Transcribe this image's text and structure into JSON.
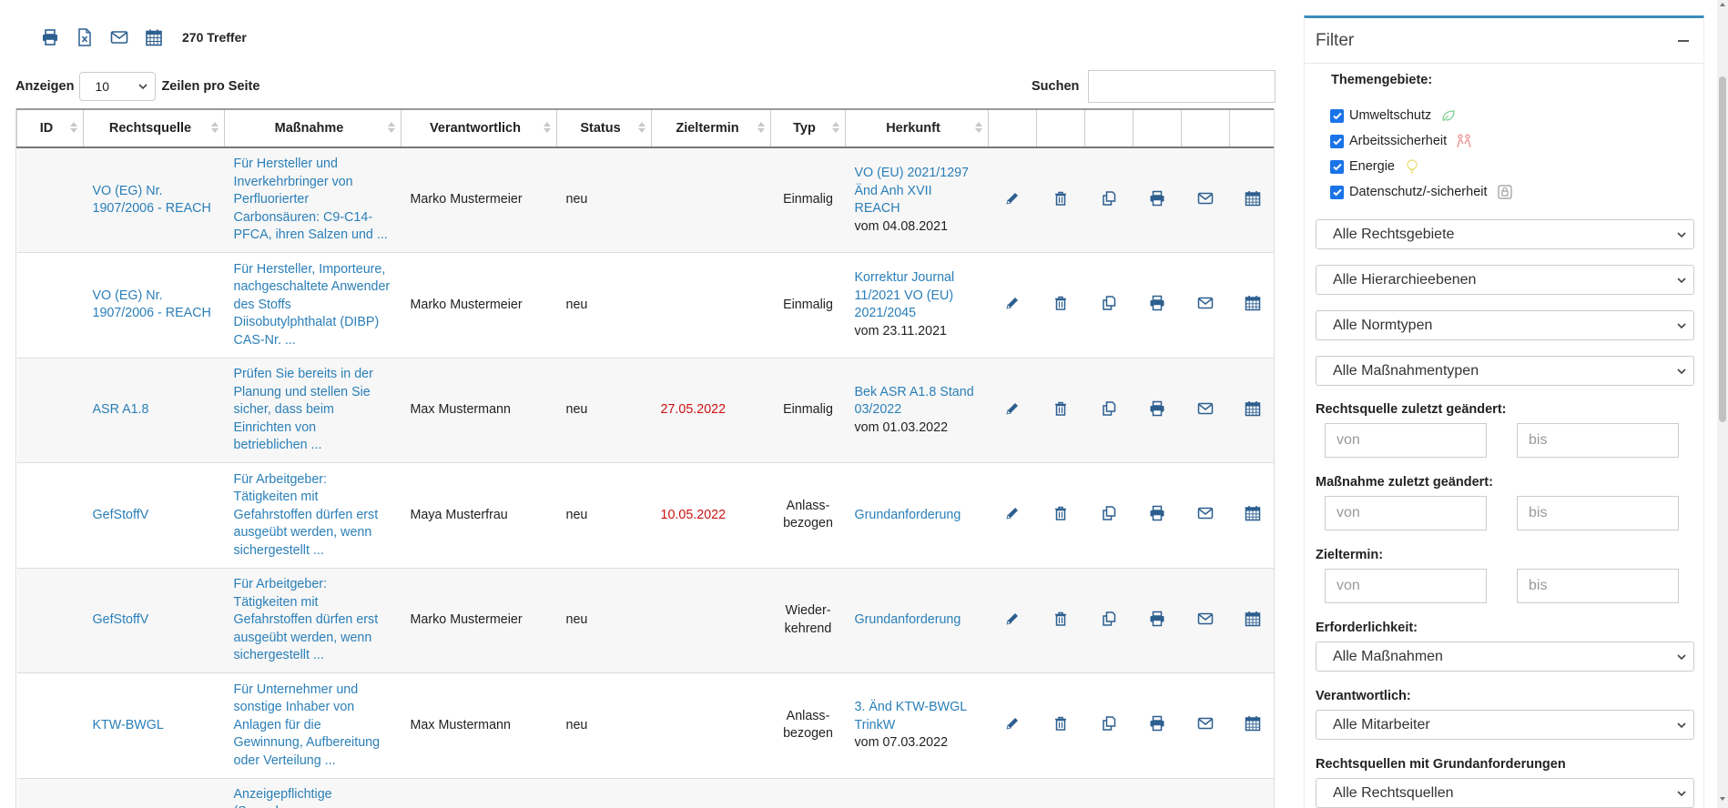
{
  "toolbar": {
    "icons": [
      "print-icon",
      "excel-icon",
      "envelope-icon",
      "calendar-icon"
    ],
    "hits": "270 Treffer"
  },
  "length": {
    "label_before": "Anzeigen",
    "value": "10",
    "label_after": "Zeilen pro Seite"
  },
  "search": {
    "label": "Suchen",
    "value": ""
  },
  "table": {
    "columns": [
      "ID",
      "Rechtsquelle",
      "Maßnahme",
      "Verantwortlich",
      "Status",
      "Zieltermin",
      "Typ",
      "Herkunft"
    ],
    "rows": [
      {
        "id": "",
        "rechtsquelle": "VO (EG) Nr. 1907/2006 - REACH",
        "massnahme": "Für Hersteller und Inverkehrbringer von Perfluorierter Carbonsäuren: C9-C14-PFCA, ihren Salzen und ...",
        "verantwortlich": "Marko Mustermeier",
        "status": "neu",
        "zieltermin": "",
        "typ": "Einmalig",
        "herkunft_link": "VO (EU) 2021/1297 Änd Anh XVII REACH",
        "herkunft_date": "vom 04.08.2021"
      },
      {
        "id": "",
        "rechtsquelle": "VO (EG) Nr. 1907/2006 - REACH",
        "massnahme": "Für Hersteller, Importeure, nachgeschaltete Anwender des Stoffs Diisobutylphthalat (DIBP) CAS-Nr. ...",
        "verantwortlich": "Marko Mustermeier",
        "status": "neu",
        "zieltermin": "",
        "typ": "Einmalig",
        "herkunft_link": "Korrektur Journal 11/2021 VO (EU) 2021/2045",
        "herkunft_date": "vom 23.11.2021"
      },
      {
        "id": "",
        "rechtsquelle": "ASR A1.8",
        "massnahme": "Prüfen Sie bereits in der Planung und stellen Sie sicher, dass beim Einrichten von betrieblichen ...",
        "verantwortlich": "Max Mustermann",
        "status": "neu",
        "zieltermin": "27.05.2022",
        "typ": "Einmalig",
        "herkunft_link": "Bek ASR A1.8 Stand 03/2022",
        "herkunft_date": "vom 01.03.2022"
      },
      {
        "id": "",
        "rechtsquelle": "GefStoffV",
        "massnahme": "Für Arbeitgeber: Tätigkeiten mit Gefahrstoffen dürfen erst ausgeübt werden, wenn sichergestellt ...",
        "verantwortlich": "Maya Musterfrau",
        "status": "neu",
        "zieltermin": "10.05.2022",
        "typ": "Anlass-bezogen",
        "herkunft_link": "Grundanforderung",
        "herkunft_date": ""
      },
      {
        "id": "",
        "rechtsquelle": "GefStoffV",
        "massnahme": "Für Arbeitgeber: Tätigkeiten mit Gefahrstoffen dürfen erst ausgeübt werden, wenn sichergestellt ...",
        "verantwortlich": "Marko Mustermeier",
        "status": "neu",
        "zieltermin": "",
        "typ": "Wieder-kehrend",
        "herkunft_link": "Grundanforderung",
        "herkunft_date": ""
      },
      {
        "id": "",
        "rechtsquelle": "KTW-BWGL",
        "massnahme": "Für Unternehmer und sonstige Inhaber von Anlagen für die Gewinnung, Aufbereitung oder Verteilung ...",
        "verantwortlich": "Max Mustermann",
        "status": "neu",
        "zieltermin": "",
        "typ": "Anlass-bezogen",
        "herkunft_link": "3. Änd KTW-BWGL TrinkW",
        "herkunft_date": "vom 07.03.2022"
      }
    ],
    "partial_row_massnahme": "Anzeigepflichtige (Sammler,",
    "row_actions": [
      "pencil-icon",
      "trash-icon",
      "copy-icon",
      "print-icon",
      "envelope-icon",
      "calendar-icon"
    ]
  },
  "filter": {
    "title": "Filter",
    "themen_label": "Themengebiete:",
    "themen": [
      {
        "label": "Umweltschutz",
        "checked": true,
        "icon": "leaf-icon"
      },
      {
        "label": "Arbeitssicherheit",
        "checked": true,
        "icon": "workers-icon"
      },
      {
        "label": "Energie",
        "checked": true,
        "icon": "lightbulb-icon"
      },
      {
        "label": "Datenschutz/-sicherheit",
        "checked": true,
        "icon": "lock-file-icon"
      }
    ],
    "selects": [
      "Alle Rechtsgebiete",
      "Alle Hierarchieebenen",
      "Alle Normtypen",
      "Alle Maßnahmentypen"
    ],
    "rq_changed_label": "Rechtsquelle zuletzt geändert:",
    "m_changed_label": "Maßnahme zuletzt geändert:",
    "zieltermin_label": "Zieltermin:",
    "von": "von",
    "bis": "bis",
    "erforderlichkeit_label": "Erforderlichkeit:",
    "erforderlichkeit_value": "Alle Maßnahmen",
    "verantwortlich_label": "Verantwortlich:",
    "verantwortlich_value": "Alle Mitarbeiter",
    "grund_label": "Rechtsquellen mit Grundanforderungen",
    "grund_value": "Alle Rechtsquellen"
  },
  "colors": {
    "link": "#2a7fb8",
    "icon": "#2d5f8f",
    "due": "#cc1111",
    "accent": "#3c8dbc",
    "checkbox": "#1a73e8"
  }
}
